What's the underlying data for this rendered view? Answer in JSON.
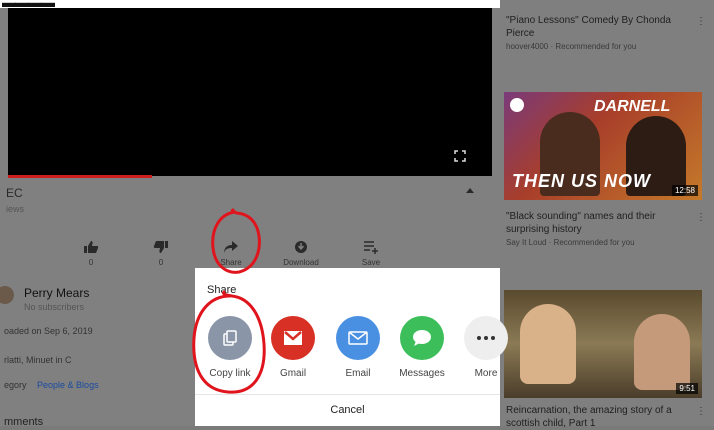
{
  "video": {
    "title_fragment": "EC",
    "views_fragment": "iews"
  },
  "actions": [
    {
      "label": "0",
      "icon": "thumbs-up-icon"
    },
    {
      "label": "0",
      "icon": "thumbs-down-icon"
    },
    {
      "label": "Share",
      "icon": "share-arrow-icon"
    },
    {
      "label": "Download",
      "icon": "download-icon"
    },
    {
      "label": "Save",
      "icon": "playlist-add-icon"
    }
  ],
  "channel": {
    "name": "Perry Mears",
    "subscribers": "No subscribers"
  },
  "details": {
    "uploaded": "oaded on Sep 6, 2019",
    "music": "rlatti, Minuet in C",
    "category_label": "egory",
    "category_link": "People & Blogs",
    "comments": "mments"
  },
  "recommendations": [
    {
      "title": "\"Piano Lessons\" Comedy By Chonda Pierce",
      "meta": "hoover4000 · Recommended for you"
    },
    {
      "title": "\"Black sounding\" names and their surprising history",
      "meta": "Say It Loud · Recommended for you",
      "thumb_text_top": "DARNELL",
      "thumb_text_bottom": "THEN  US  NOW",
      "duration": "12:58"
    },
    {
      "title": "Reincarnation, the amazing story of a scottish child, Part 1",
      "duration": "9:51"
    }
  ],
  "share_sheet": {
    "title": "Share",
    "options": [
      {
        "label": "Copy link",
        "color": "#8a96a8"
      },
      {
        "label": "Gmail",
        "color": "#d93025"
      },
      {
        "label": "Email",
        "color": "#4a90e2"
      },
      {
        "label": "Messages",
        "color": "#3cbf5a"
      },
      {
        "label": "More",
        "color": "#eeeeee"
      }
    ],
    "cancel": "Cancel"
  },
  "colors": {
    "annotation": "#e0141c",
    "progress": "#cc1f1f"
  }
}
